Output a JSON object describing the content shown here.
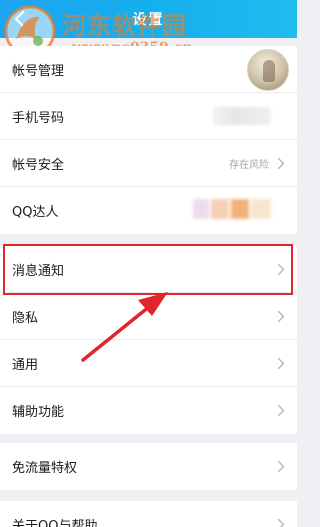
{
  "header": {
    "title": "设置"
  },
  "watermark": {
    "site_name": "河东软件园",
    "url": "www.pc0359.cn"
  },
  "rows": {
    "account_management": {
      "label": "帐号管理"
    },
    "phone_number": {
      "label": "手机号码"
    },
    "account_security": {
      "label": "帐号安全",
      "status": "存在风险"
    },
    "qq_expert": {
      "label": "QQ达人"
    },
    "message_notifications": {
      "label": "消息通知"
    },
    "privacy": {
      "label": "隐私"
    },
    "general": {
      "label": "通用"
    },
    "accessibility": {
      "label": "辅助功能"
    },
    "free_data": {
      "label": "免流量特权"
    },
    "about": {
      "label": "关于QQ与帮助"
    }
  },
  "icons": {
    "back": "back-arrow-icon",
    "chevron": "chevron-right-icon",
    "watermark_logo": "watermark-logo-icon",
    "annotation_arrow": "annotation-arrow"
  },
  "colors": {
    "header_gradient_start": "#1ea4f0",
    "header_gradient_end": "#1fbcef",
    "highlight_red": "#e0262c",
    "watermark_orange": "#ec7e26",
    "status_gray": "#a6a6a6"
  }
}
